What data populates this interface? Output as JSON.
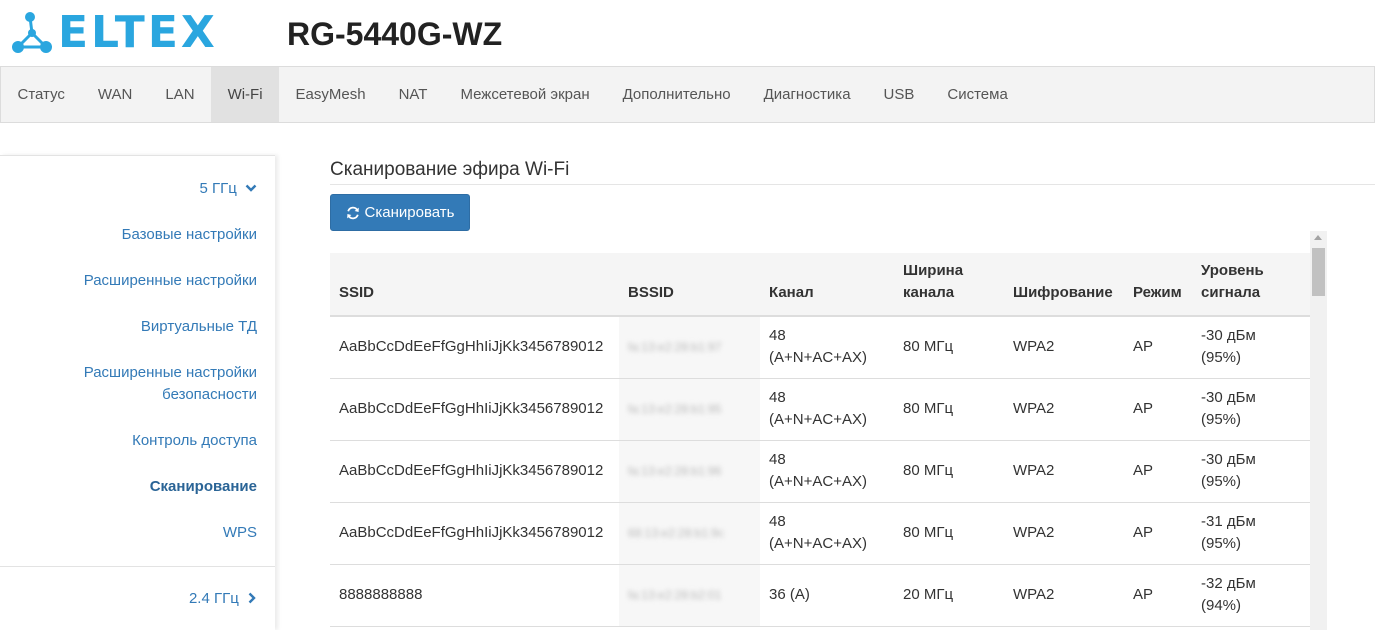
{
  "header": {
    "logo_text": "ELTEX",
    "model": "RG-5440G-WZ",
    "colors": {
      "brand": "#2aa6df"
    }
  },
  "nav": {
    "items": [
      {
        "label": "Статус",
        "active": false
      },
      {
        "label": "WAN",
        "active": false
      },
      {
        "label": "LAN",
        "active": false
      },
      {
        "label": "Wi-Fi",
        "active": true
      },
      {
        "label": "EasyMesh",
        "active": false
      },
      {
        "label": "NAT",
        "active": false
      },
      {
        "label": "Межсетевой экран",
        "active": false
      },
      {
        "label": "Дополнительно",
        "active": false
      },
      {
        "label": "Диагностика",
        "active": false
      },
      {
        "label": "USB",
        "active": false
      },
      {
        "label": "Система",
        "active": false
      }
    ]
  },
  "sidebar": {
    "group_5g": "5 ГГц",
    "items": [
      {
        "label": "Базовые настройки"
      },
      {
        "label": "Расширенные настройки"
      },
      {
        "label": "Виртуальные ТД"
      },
      {
        "label_line1": "Расширенные настройки",
        "label_line2": "безопасности"
      },
      {
        "label": "Контроль доступа"
      },
      {
        "label": "Сканирование",
        "active": true
      },
      {
        "label": "WPS"
      }
    ],
    "group_24g": "2.4 ГГц"
  },
  "main": {
    "title": "Сканирование эфира Wi-Fi",
    "scan_button": "Сканировать",
    "colors": {
      "primary": "#337ab7"
    }
  },
  "table": {
    "headers": {
      "ssid": "SSID",
      "bssid": "BSSID",
      "channel": "Канал",
      "width_line1": "Ширина",
      "width_line2": "канала",
      "encryption": "Шифрование",
      "mode": "Режим",
      "signal_line1": "Уровень",
      "signal_line2": "сигнала"
    },
    "rows": [
      {
        "ssid": "AaBbCcDdEeFfGgHhIiJjKk3456789012",
        "bssid": "fa:13:e2:28:b1:97",
        "channel_line1": "48",
        "channel_line2": "(A+N+AC+AX)",
        "width": "80 МГц",
        "encryption": "WPA2",
        "mode": "AP",
        "signal_line1": "-30 дБм",
        "signal_line2": "(95%)"
      },
      {
        "ssid": "AaBbCcDdEeFfGgHhIiJjKk3456789012",
        "bssid": "fa:13:e2:28:b1:95",
        "channel_line1": "48",
        "channel_line2": "(A+N+AC+AX)",
        "width": "80 МГц",
        "encryption": "WPA2",
        "mode": "AP",
        "signal_line1": "-30 дБм",
        "signal_line2": "(95%)"
      },
      {
        "ssid": "AaBbCcDdEeFfGgHhIiJjKk3456789012",
        "bssid": "fa:13:e2:28:b1:96",
        "channel_line1": "48",
        "channel_line2": "(A+N+AC+AX)",
        "width": "80 МГц",
        "encryption": "WPA2",
        "mode": "AP",
        "signal_line1": "-30 дБм",
        "signal_line2": "(95%)"
      },
      {
        "ssid": "AaBbCcDdEeFfGgHhIiJjKk3456789012",
        "bssid": "68:13:e2:28:b1:9c",
        "channel_line1": "48",
        "channel_line2": "(A+N+AC+AX)",
        "width": "80 МГц",
        "encryption": "WPA2",
        "mode": "AP",
        "signal_line1": "-31 дБм",
        "signal_line2": "(95%)"
      },
      {
        "ssid": "8888888888",
        "bssid": "fa:13:e2:28:b2:01",
        "channel_line1": "36 (A)",
        "channel_line2": "",
        "width": "20 МГц",
        "encryption": "WPA2",
        "mode": "AP",
        "signal_line1": "-32 дБм",
        "signal_line2": "(94%)"
      }
    ]
  },
  "icons": {
    "logo": "eltex-network-logo-icon",
    "chevron_down": "chevron-down-icon",
    "chevron_right": "chevron-right-icon",
    "refresh": "refresh-icon"
  }
}
